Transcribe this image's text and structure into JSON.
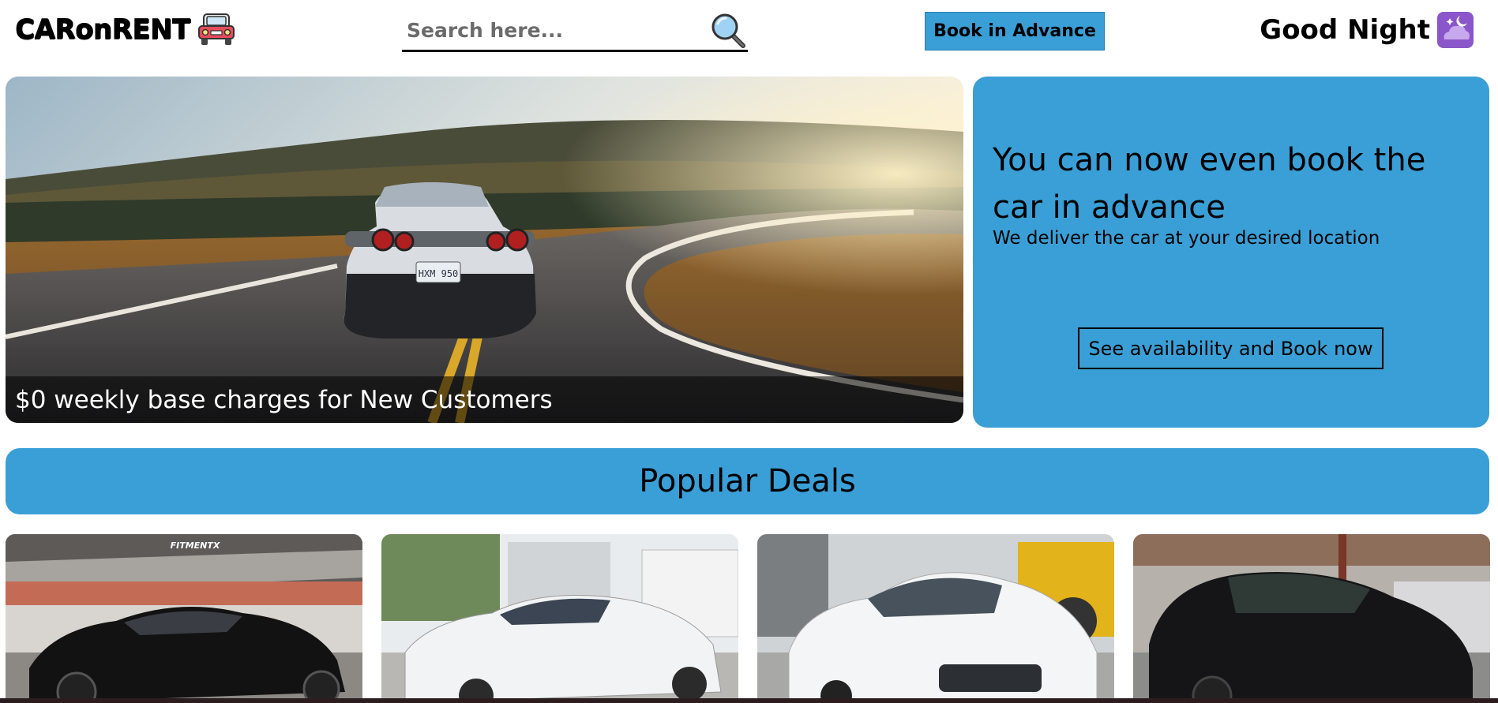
{
  "header": {
    "brand": "CARonRENT",
    "brand_icon": "car-icon",
    "search": {
      "placeholder": "Search here...",
      "value": ""
    },
    "search_icon": "magnifier-icon",
    "advance_button": "Book in Advance",
    "greeting": "Good Night",
    "greeting_icon": "moon-stars-icon"
  },
  "hero": {
    "caption": "$0 weekly base charges for New Customers",
    "plate": "HXM 950"
  },
  "promo": {
    "title": "You can now even book the car in advance",
    "subtitle": "We deliver the car at your desired location",
    "button": "See availability and Book now"
  },
  "deals": {
    "title": "Popular Deals",
    "cards": [
      {
        "image": "black-sedan-garage",
        "watermark": "FITMENTX"
      },
      {
        "image": "white-sedan-driveway"
      },
      {
        "image": "white-hyundai-lot"
      },
      {
        "image": "black-dodge-warehouse"
      }
    ]
  },
  "colors": {
    "accent": "#3a9fd6",
    "text": "#000000",
    "background": "#ffffff"
  }
}
